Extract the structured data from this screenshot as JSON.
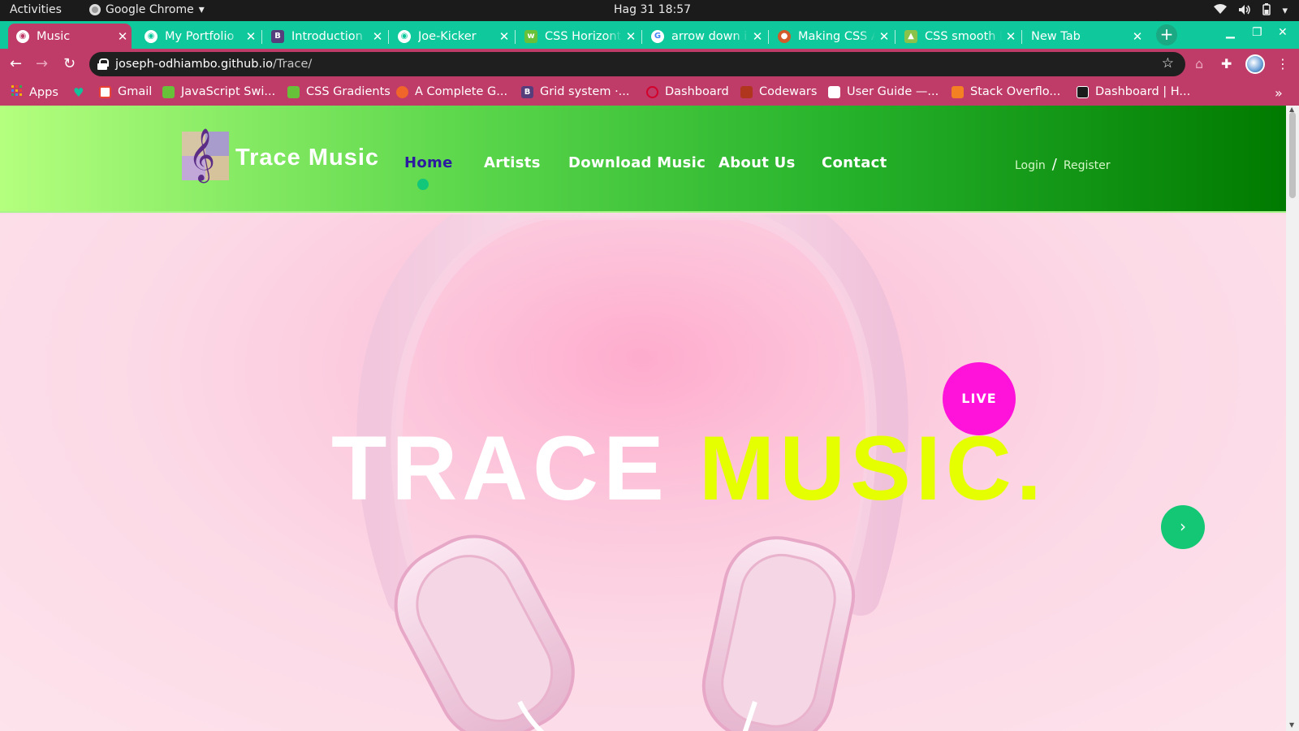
{
  "system_bar": {
    "activities": "Activities",
    "app_name": "Google Chrome",
    "clock": "Hag 31  18:57"
  },
  "tabs": [
    {
      "title": "Music",
      "active": true
    },
    {
      "title": "My Portfolio",
      "active": false
    },
    {
      "title": "Introduction",
      "active": false
    },
    {
      "title": "Joe-Kicker",
      "active": false
    },
    {
      "title": "CSS Horizont",
      "active": false
    },
    {
      "title": "arrow down i",
      "active": false
    },
    {
      "title": "Making CSS A",
      "active": false
    },
    {
      "title": "CSS smooth b",
      "active": false
    },
    {
      "title": "New Tab",
      "active": false
    }
  ],
  "omnibox": {
    "host": "joseph-odhiambo.github.io",
    "path": "/Trace/"
  },
  "bookmarks": [
    {
      "label": "Apps",
      "color": "#f4b400"
    },
    {
      "label": "",
      "color": "#11c29a"
    },
    {
      "label": "Gmail",
      "color": "#ea4335"
    },
    {
      "label": "JavaScript Swi...",
      "color": "#67c23a"
    },
    {
      "label": "CSS Gradients",
      "color": "#67c23a"
    },
    {
      "label": "A Complete G...",
      "color": "#f06529"
    },
    {
      "label": "Grid system ·...",
      "color": "#563d7c"
    },
    {
      "label": "Dashboard",
      "color": "#d3002b"
    },
    {
      "label": "Codewars",
      "color": "#b1361e"
    },
    {
      "label": "User Guide —...",
      "color": "#ffffff"
    },
    {
      "label": "Stack Overflo...",
      "color": "#f48024"
    },
    {
      "label": "Dashboard | H...",
      "color": "#1b1b1b"
    }
  ],
  "site": {
    "title": "Trace Music",
    "nav": [
      "Home",
      "Artists",
      "Download Music",
      "About Us",
      "Contact"
    ],
    "login": "Login",
    "auth_sep": "/",
    "register": "Register"
  },
  "hero": {
    "title_part1": "TRACE",
    "title_part2": "MUSIC.",
    "live_badge": "LIVE",
    "next_icon": "chevron-right-icon"
  },
  "colors": {
    "tab_strip": "#0fc99c",
    "toolbar": "#bf3b68",
    "hero_accent": "#e6ff00",
    "live_badge": "#ff12d9",
    "next_button": "#13c774"
  }
}
